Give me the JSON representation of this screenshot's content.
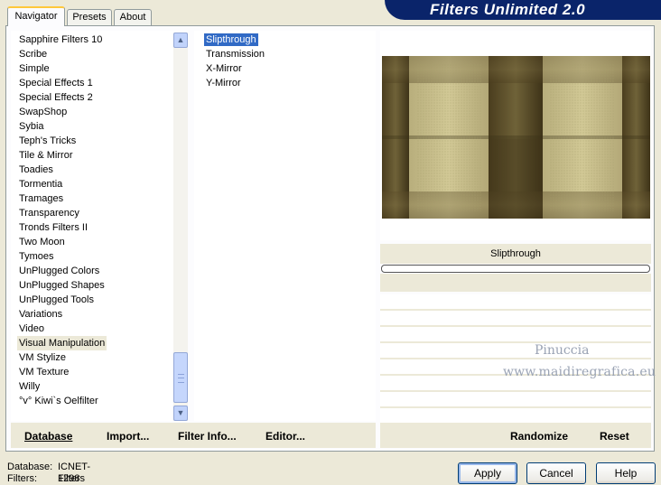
{
  "tabs": [
    {
      "label": "Navigator",
      "active": true
    },
    {
      "label": "Presets",
      "active": false
    },
    {
      "label": "About",
      "active": false
    }
  ],
  "banner": {
    "title": "Filters Unlimited 2.0"
  },
  "categories": {
    "items": [
      "Sapphire Filters 10",
      "Scribe",
      "Simple",
      "Special Effects 1",
      "Special Effects 2",
      "SwapShop",
      "Sybia",
      "Teph's Tricks",
      "Tile & Mirror",
      "Toadies",
      "Tormentia",
      "Tramages",
      "Transparency",
      "Tronds Filters II",
      "Two Moon",
      "Tymoes",
      "UnPlugged Colors",
      "UnPlugged Shapes",
      "UnPlugged Tools",
      "Variations",
      "Video",
      "Visual Manipulation",
      "VM Stylize",
      "VM Texture",
      "Willy",
      "°v° Kiwi`s Oelfilter"
    ],
    "selected": "Visual Manipulation"
  },
  "filters": {
    "items": [
      "Slipthrough",
      "Transmission",
      "X-Mirror",
      "Y-Mirror"
    ],
    "selected": "Slipthrough"
  },
  "preview": {
    "filter_name": "Slipthrough",
    "watermark_line1": "Pinuccia",
    "watermark_line2": "www.maidiregrafica.eu"
  },
  "toolbar": {
    "database_label": "Database",
    "import_label": "Import...",
    "filter_info_label": "Filter Info...",
    "editor_label": "Editor...",
    "randomize_label": "Randomize",
    "reset_label": "Reset"
  },
  "status": {
    "database_label": "Database:",
    "database_value": "ICNET-Filters",
    "filters_label": "Filters:",
    "filters_value": "1298"
  },
  "dialog": {
    "apply_label": "Apply",
    "cancel_label": "Cancel",
    "help_label": "Help"
  },
  "colors": {
    "banner": "#0a246a",
    "selection": "#316ac5",
    "face": "#ece9d8"
  }
}
